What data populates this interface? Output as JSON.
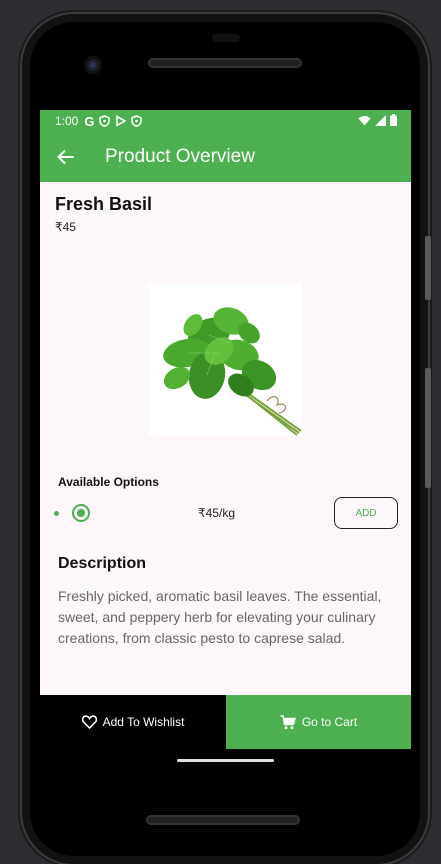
{
  "status_bar": {
    "time": "1:00",
    "icons": [
      "google-icon",
      "shield-icon",
      "play-icon",
      "shield-icon"
    ],
    "right_icons": [
      "wifi-icon",
      "signal-icon",
      "battery-icon"
    ]
  },
  "app_bar": {
    "title": "Product Overview",
    "back_icon": "arrow-back-icon",
    "color": "#4caf50"
  },
  "product": {
    "name": "Fresh Basil",
    "price": "₹45",
    "image": "basil-image"
  },
  "options": {
    "heading": "Available Options",
    "items": [
      {
        "price": "₹45/kg",
        "selected": true,
        "add_label": "ADD"
      }
    ]
  },
  "description": {
    "heading": "Description",
    "text": "Freshly picked, aromatic basil leaves. The essential, sweet, and peppery herb for elevating your culinary creations, from classic pesto to caprese salad."
  },
  "bottom_bar": {
    "wishlist_label": "Add To Wishlist",
    "wishlist_icon": "heart-outline-icon",
    "cart_label": "Go to Cart",
    "cart_icon": "cart-icon"
  },
  "colors": {
    "accent": "#4caf50",
    "background": "#fdf7fc",
    "text_muted": "#666666"
  }
}
